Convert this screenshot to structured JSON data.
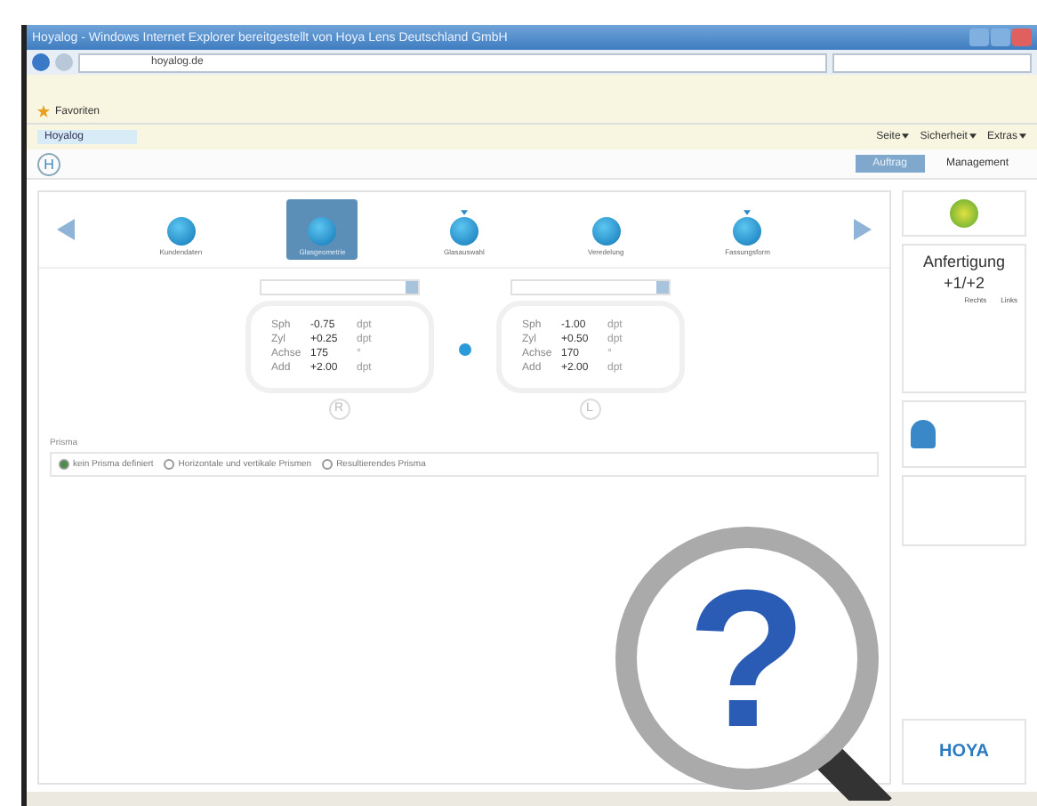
{
  "window": {
    "title": "Hoyalog - Windows Internet Explorer bereitgestellt von Hoya Lens Deutschland GmbH"
  },
  "address_bar": {
    "url": "hoyalog.de"
  },
  "favorites": {
    "label": "Favoriten"
  },
  "tab": {
    "label": "Hoyalog"
  },
  "command_menus": [
    "Seite",
    "Sicherheit",
    "Extras"
  ],
  "app_tabs": [
    {
      "label": "Auftrag",
      "selected": true
    },
    {
      "label": "Management",
      "selected": false
    }
  ],
  "steps": [
    {
      "label": "Kundendaten",
      "selected": false,
      "flagged": false
    },
    {
      "label": "Glasgeometrie",
      "selected": true,
      "flagged": false
    },
    {
      "label": "Glasauswahl",
      "selected": false,
      "flagged": true
    },
    {
      "label": "Veredelung",
      "selected": false,
      "flagged": false
    },
    {
      "label": "Fassungsform",
      "selected": false,
      "flagged": true
    }
  ],
  "lenses": [
    {
      "side": "R",
      "rows": [
        {
          "label": "Sph",
          "value": "-0.75",
          "unit": "dpt"
        },
        {
          "label": "Zyl",
          "value": "+0.25",
          "unit": "dpt"
        },
        {
          "label": "Achse",
          "value": "175",
          "unit": "°"
        },
        {
          "label": "Add",
          "value": "+2.00",
          "unit": "dpt"
        }
      ]
    },
    {
      "side": "L",
      "rows": [
        {
          "label": "Sph",
          "value": "-1.00",
          "unit": "dpt"
        },
        {
          "label": "Zyl",
          "value": "+0.50",
          "unit": "dpt"
        },
        {
          "label": "Achse",
          "value": "170",
          "unit": "°"
        },
        {
          "label": "Add",
          "value": "+2.00",
          "unit": "dpt"
        }
      ]
    }
  ],
  "prism": {
    "title": "Prisma",
    "options": [
      {
        "label": "kein Prisma definiert",
        "selected": true
      },
      {
        "label": "Horizontale und vertikale Prismen",
        "selected": false
      },
      {
        "label": "Resultierendes Prisma",
        "selected": false
      }
    ]
  },
  "sidebar": {
    "status": "Anfertigung",
    "code": "+1/+2",
    "columns": [
      "Rechts",
      "Links"
    ]
  },
  "logo": "HOYA",
  "app_logo": "H",
  "overlay": {
    "symbol": "?"
  }
}
